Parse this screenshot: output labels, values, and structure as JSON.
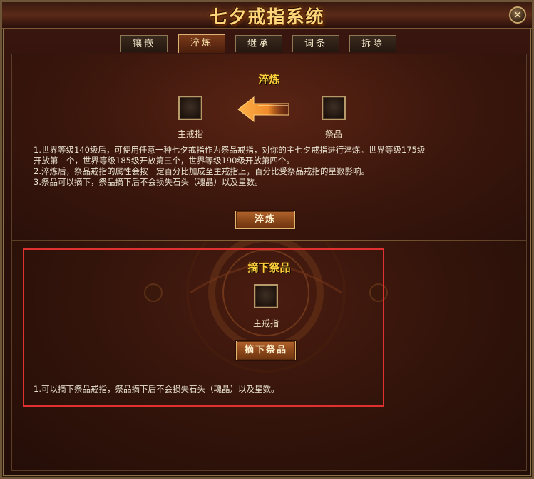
{
  "window": {
    "title": "七夕戒指系统",
    "close_glyph": "✕"
  },
  "tabs": [
    {
      "label": "镶嵌",
      "active": false
    },
    {
      "label": "淬炼",
      "active": true
    },
    {
      "label": "继承",
      "active": false
    },
    {
      "label": "词条",
      "active": false
    },
    {
      "label": "拆除",
      "active": false
    }
  ],
  "refine": {
    "title": "淬炼",
    "main_ring_label": "主戒指",
    "sacrifice_label": "祭品",
    "description": [
      "1.世界等级140级后，可使用任意一种七夕戒指作为祭品戒指，对你的主七夕戒指进行淬炼。世界等级175级",
      "开放第二个，世界等级185级开放第三个，世界等级190级开放第四个。",
      "2.淬炼后，祭品戒指的属性会按一定百分比加成至主戒指上，百分比受祭品戒指的星数影响。",
      "3.祭品可以摘下，祭品摘下后不会损失石头（魂晶）以及星数。"
    ],
    "button_label": "淬炼"
  },
  "remove": {
    "title": "摘下祭品",
    "main_ring_label": "主戒指",
    "button_label": "摘下祭品",
    "description": "1.可以摘下祭品戒指，祭品摘下后不会损失石头（魂晶）以及星数。"
  },
  "colors": {
    "accent_gold": "#ffcf3c",
    "highlight_red": "#e03030",
    "arrow_orange": "#f08a2a"
  }
}
